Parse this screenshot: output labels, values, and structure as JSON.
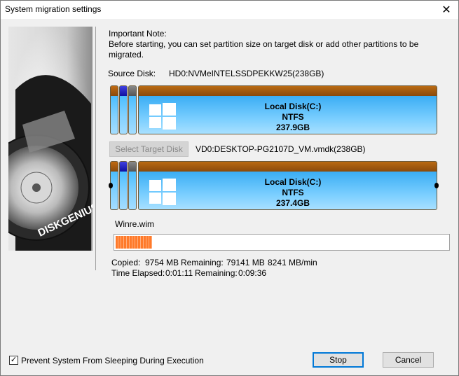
{
  "window": {
    "title": "System migration settings"
  },
  "note": {
    "heading": "Important Note:",
    "line1": "Before starting, you can set partition size on target disk or add other partitions to be",
    "line2": "migrated."
  },
  "source": {
    "label": "Source Disk:",
    "value": "HD0:NVMeINTELSSDPEKKW25(238GB)",
    "partition": {
      "name": "Local Disk(C:)",
      "fs": "NTFS",
      "size": "237.9GB"
    }
  },
  "target": {
    "button": "Select Target Disk",
    "value": "VD0:DESKTOP-PG2107D_VM.vmdk(238GB)",
    "partition": {
      "name": "Local Disk(C:)",
      "fs": "NTFS",
      "size": "237.4GB"
    }
  },
  "progress": {
    "file": "Winre.wim",
    "fraction": 0.11
  },
  "stats": {
    "copied_label": "Copied:",
    "copied": "9754 MB",
    "remaining_label": "Remaining:",
    "remaining": "79141 MB",
    "rate": "8241 MB/min",
    "elapsed_label": "Time Elapsed:",
    "elapsed": "0:01:11",
    "time_remaining_label": "Remaining:",
    "time_remaining": "0:09:36"
  },
  "footer": {
    "prevent_sleep": "Prevent System From Sleeping During Execution",
    "prevent_sleep_checked": true,
    "stop": "Stop",
    "cancel": "Cancel"
  },
  "side_image": {
    "brand": "DISKGENIUS"
  }
}
